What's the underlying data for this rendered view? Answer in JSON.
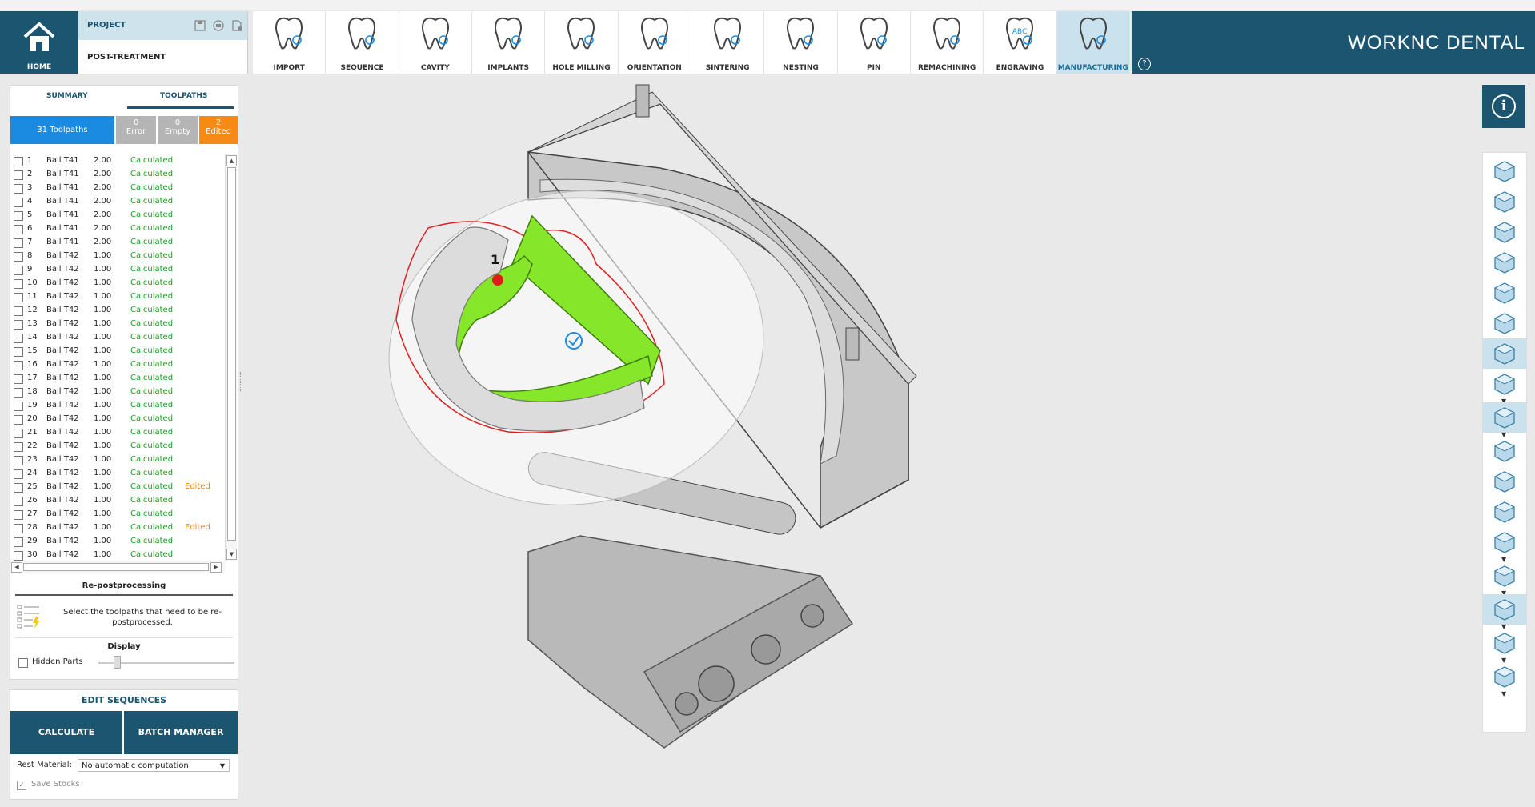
{
  "app": {
    "brand": "WORKNC DENTAL"
  },
  "home": {
    "label": "HOME"
  },
  "project": {
    "title": "PROJECT",
    "name": "POST-TREATMENT"
  },
  "toolbar": {
    "items": [
      {
        "label": "IMPORT",
        "icon": "tooth-plus-icon"
      },
      {
        "label": "SEQUENCE",
        "icon": "tooth-layers-icon"
      },
      {
        "label": "CAVITY",
        "icon": "tooth-cavity-icon"
      },
      {
        "label": "IMPLANTS",
        "icon": "tooth-implant-icon"
      },
      {
        "label": "HOLE MILLING",
        "icon": "tooth-hole-icon"
      },
      {
        "label": "ORIENTATION",
        "icon": "tooth-orientation-icon"
      },
      {
        "label": "SINTERING",
        "icon": "tooth-heat-icon"
      },
      {
        "label": "NESTING",
        "icon": "tooth-nesting-icon"
      },
      {
        "label": "PIN",
        "icon": "tooth-pin-icon"
      },
      {
        "label": "REMACHINING",
        "icon": "tooth-remachining-icon"
      },
      {
        "label": "ENGRAVING",
        "icon": "tooth-engraving-icon",
        "text": "ABC"
      },
      {
        "label": "MANUFACTURING",
        "icon": "tooth-manufacturing-icon",
        "active": true
      }
    ]
  },
  "left": {
    "tabs": {
      "summary": "SUMMARY",
      "toolpaths": "TOOLPATHS"
    },
    "counts": {
      "total": "31 Toolpaths",
      "error_n": "0",
      "error_t": "Error",
      "empty_n": "0",
      "empty_t": "Empty",
      "edited_n": "2",
      "edited_t": "Edited"
    },
    "rows": [
      {
        "n": "1",
        "tool": "Ball T41",
        "v": "2.00",
        "status": "Calculated",
        "edited": ""
      },
      {
        "n": "2",
        "tool": "Ball T41",
        "v": "2.00",
        "status": "Calculated",
        "edited": ""
      },
      {
        "n": "3",
        "tool": "Ball T41",
        "v": "2.00",
        "status": "Calculated",
        "edited": ""
      },
      {
        "n": "4",
        "tool": "Ball T41",
        "v": "2.00",
        "status": "Calculated",
        "edited": ""
      },
      {
        "n": "5",
        "tool": "Ball T41",
        "v": "2.00",
        "status": "Calculated",
        "edited": ""
      },
      {
        "n": "6",
        "tool": "Ball T41",
        "v": "2.00",
        "status": "Calculated",
        "edited": ""
      },
      {
        "n": "7",
        "tool": "Ball T41",
        "v": "2.00",
        "status": "Calculated",
        "edited": ""
      },
      {
        "n": "8",
        "tool": "Ball T42",
        "v": "1.00",
        "status": "Calculated",
        "edited": ""
      },
      {
        "n": "9",
        "tool": "Ball T42",
        "v": "1.00",
        "status": "Calculated",
        "edited": ""
      },
      {
        "n": "10",
        "tool": "Ball T42",
        "v": "1.00",
        "status": "Calculated",
        "edited": ""
      },
      {
        "n": "11",
        "tool": "Ball T42",
        "v": "1.00",
        "status": "Calculated",
        "edited": ""
      },
      {
        "n": "12",
        "tool": "Ball T42",
        "v": "1.00",
        "status": "Calculated",
        "edited": ""
      },
      {
        "n": "13",
        "tool": "Ball T42",
        "v": "1.00",
        "status": "Calculated",
        "edited": ""
      },
      {
        "n": "14",
        "tool": "Ball T42",
        "v": "1.00",
        "status": "Calculated",
        "edited": ""
      },
      {
        "n": "15",
        "tool": "Ball T42",
        "v": "1.00",
        "status": "Calculated",
        "edited": ""
      },
      {
        "n": "16",
        "tool": "Ball T42",
        "v": "1.00",
        "status": "Calculated",
        "edited": ""
      },
      {
        "n": "17",
        "tool": "Ball T42",
        "v": "1.00",
        "status": "Calculated",
        "edited": ""
      },
      {
        "n": "18",
        "tool": "Ball T42",
        "v": "1.00",
        "status": "Calculated",
        "edited": ""
      },
      {
        "n": "19",
        "tool": "Ball T42",
        "v": "1.00",
        "status": "Calculated",
        "edited": ""
      },
      {
        "n": "20",
        "tool": "Ball T42",
        "v": "1.00",
        "status": "Calculated",
        "edited": ""
      },
      {
        "n": "21",
        "tool": "Ball T42",
        "v": "1.00",
        "status": "Calculated",
        "edited": ""
      },
      {
        "n": "22",
        "tool": "Ball T42",
        "v": "1.00",
        "status": "Calculated",
        "edited": ""
      },
      {
        "n": "23",
        "tool": "Ball T42",
        "v": "1.00",
        "status": "Calculated",
        "edited": ""
      },
      {
        "n": "24",
        "tool": "Ball T42",
        "v": "1.00",
        "status": "Calculated",
        "edited": ""
      },
      {
        "n": "25",
        "tool": "Ball T42",
        "v": "1.00",
        "status": "Calculated",
        "edited": "Edited"
      },
      {
        "n": "26",
        "tool": "Ball T42",
        "v": "1.00",
        "status": "Calculated",
        "edited": ""
      },
      {
        "n": "27",
        "tool": "Ball T42",
        "v": "1.00",
        "status": "Calculated",
        "edited": ""
      },
      {
        "n": "28",
        "tool": "Ball T42",
        "v": "1.00",
        "status": "Calculated",
        "edited": "Edited"
      },
      {
        "n": "29",
        "tool": "Ball T42",
        "v": "1.00",
        "status": "Calculated",
        "edited": ""
      },
      {
        "n": "30",
        "tool": "Ball T42",
        "v": "1.00",
        "status": "Calculated",
        "edited": ""
      }
    ],
    "repost": {
      "title": "Re-postprocessing",
      "text": "Select the toolpaths that need to be re-postprocessed."
    },
    "display": {
      "title": "Display",
      "hidden_parts": "Hidden Parts"
    }
  },
  "bottom": {
    "edit_sequences": "EDIT SEQUENCES",
    "calculate": "CALCULATE",
    "batch_manager": "BATCH MANAGER",
    "rest_material_label": "Rest Material:",
    "rest_material_value": "No automatic computation",
    "save_stocks": "Save Stocks"
  },
  "viewport": {
    "marker_label": "1"
  },
  "colors": {
    "brand": "#1b5570",
    "accent": "#1a8be0",
    "edited": "#f58a17",
    "calculated": "#1e9c23",
    "support": "#86e62a"
  }
}
